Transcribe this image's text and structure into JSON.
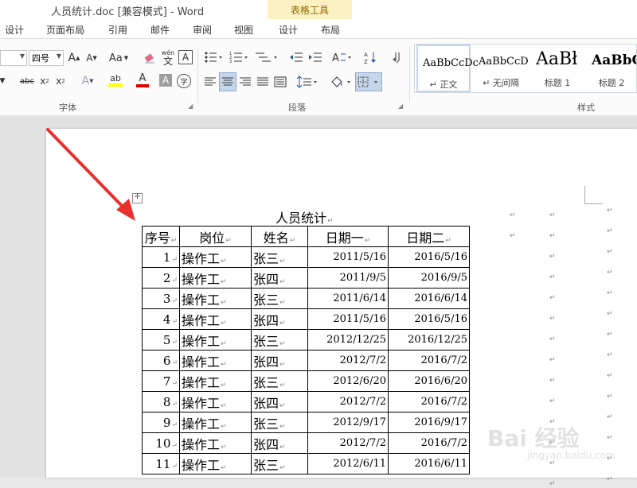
{
  "window": {
    "title": "人员统计.doc [兼容模式] - Word"
  },
  "context_tab": {
    "label": "表格工具"
  },
  "tabs": [
    "设计",
    "页面布局",
    "引用",
    "邮件",
    "审阅",
    "视图",
    "设计",
    "布局"
  ],
  "ribbon": {
    "font_size": "四号",
    "font_group": "字体",
    "paragraph_group": "段落",
    "styles_group": "样式",
    "font_buttons": {
      "grow": "A",
      "shrink": "A",
      "case": "Aa",
      "phonetic_top": "wén",
      "phonetic_bottom": "文",
      "border_char": "A",
      "strike": "abc",
      "sub": "x",
      "sup": "x",
      "text_effect": "A",
      "highlight": "ab",
      "font_color": "A",
      "char_shading": "A",
      "enclose": "字"
    },
    "styles": [
      {
        "preview": "AaBbCcDc",
        "name": "正文"
      },
      {
        "preview": "AaBbCcDc",
        "name": "无间隔"
      },
      {
        "preview": "AaBł",
        "name": "标题 1"
      },
      {
        "preview": "AaBbC",
        "name": "标题 2"
      }
    ]
  },
  "document": {
    "title": "人员统计",
    "headers": [
      "序号",
      "岗位",
      "姓名",
      "日期一",
      "日期二"
    ],
    "rows": [
      [
        "1",
        "操作工",
        "张三",
        "2011/5/16",
        "2016/5/16"
      ],
      [
        "2",
        "操作工",
        "张四",
        "2011/9/5",
        "2016/9/5"
      ],
      [
        "3",
        "操作工",
        "张三",
        "2011/6/14",
        "2016/6/14"
      ],
      [
        "4",
        "操作工",
        "张四",
        "2011/5/16",
        "2016/5/16"
      ],
      [
        "5",
        "操作工",
        "张三",
        "2012/12/25",
        "2016/12/25"
      ],
      [
        "6",
        "操作工",
        "张四",
        "2012/7/2",
        "2016/7/2"
      ],
      [
        "7",
        "操作工",
        "张三",
        "2012/6/20",
        "2016/6/20"
      ],
      [
        "8",
        "操作工",
        "张四",
        "2012/7/2",
        "2016/7/2"
      ],
      [
        "9",
        "操作工",
        "张三",
        "2012/9/17",
        "2016/9/17"
      ],
      [
        "10",
        "操作工",
        "张四",
        "2012/7/2",
        "2016/7/2"
      ],
      [
        "11",
        "操作工",
        "张三",
        "2012/6/11",
        "2016/6/11"
      ]
    ]
  },
  "watermark": {
    "main": "Bai 经验",
    "sub": "jingyan.baidu.com"
  },
  "colors": {
    "accent": "#2b579a",
    "highlight": "#ffff00",
    "font_color": "#e00000",
    "arrow": "#e8312f",
    "context_tab": "#fdf1c4"
  },
  "icons": {
    "move_handle": "table-move-handle-icon",
    "annotation_arrow": "red-arrow-icon",
    "paragraph_mark": "↵"
  }
}
